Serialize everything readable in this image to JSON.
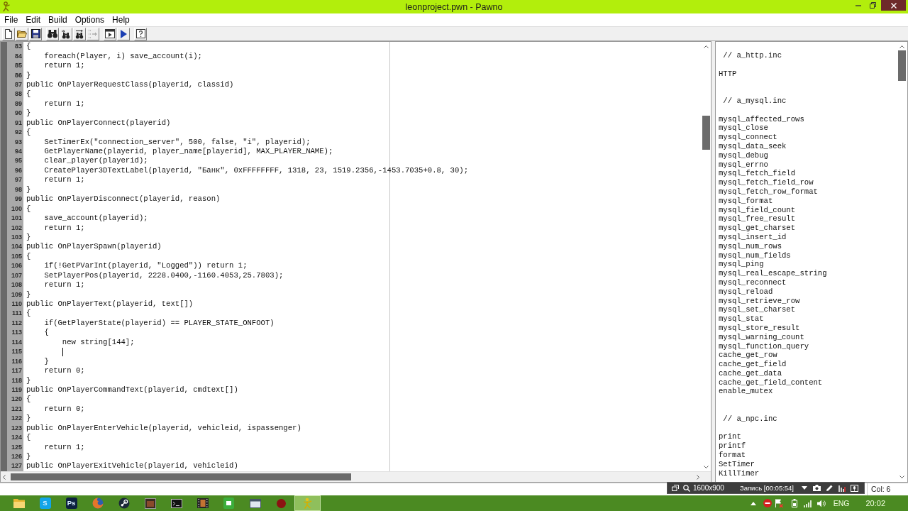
{
  "window": {
    "title": "leonproject.pwn - Pawno"
  },
  "menu": [
    "File",
    "Edit",
    "Build",
    "Options",
    "Help"
  ],
  "editor": {
    "lines": [
      {
        "number": "83",
        "text": "{",
        "caret": false
      },
      {
        "number": "84",
        "text": "    foreach(Player, i) save_account(i);",
        "caret": false
      },
      {
        "number": "85",
        "text": "    return 1;",
        "caret": false
      },
      {
        "number": "86",
        "text": "}",
        "caret": false
      },
      {
        "number": "87",
        "text": "public OnPlayerRequestClass(playerid, classid)",
        "caret": false
      },
      {
        "number": "88",
        "text": "{",
        "caret": false
      },
      {
        "number": "89",
        "text": "    return 1;",
        "caret": false
      },
      {
        "number": "90",
        "text": "}",
        "caret": false
      },
      {
        "number": "91",
        "text": "public OnPlayerConnect(playerid)",
        "caret": false
      },
      {
        "number": "92",
        "text": "{",
        "caret": false
      },
      {
        "number": "93",
        "text": "    SetTimerEx(\"connection_server\", 500, false, \"i\", playerid);",
        "caret": false
      },
      {
        "number": "94",
        "text": "    GetPlayerName(playerid, player_name[playerid], MAX_PLAYER_NAME);",
        "caret": false
      },
      {
        "number": "95",
        "text": "    clear_player(playerid);",
        "caret": false
      },
      {
        "number": "96",
        "text": "    CreatePlayer3DTextLabel(playerid, \"Банк\", 0xFFFFFFFF, 1318, 23, 1519.2356,-1453.7035+0.8, 30);",
        "caret": false
      },
      {
        "number": "97",
        "text": "    return 1;",
        "caret": false
      },
      {
        "number": "98",
        "text": "}",
        "caret": false
      },
      {
        "number": "99",
        "text": "public OnPlayerDisconnect(playerid, reason)",
        "caret": false
      },
      {
        "number": "100",
        "text": "{",
        "caret": false
      },
      {
        "number": "101",
        "text": "    save_account(playerid);",
        "caret": false
      },
      {
        "number": "102",
        "text": "    return 1;",
        "caret": false
      },
      {
        "number": "103",
        "text": "}",
        "caret": false
      },
      {
        "number": "104",
        "text": "public OnPlayerSpawn(playerid)",
        "caret": false
      },
      {
        "number": "105",
        "text": "{",
        "caret": false
      },
      {
        "number": "106",
        "text": "    if(!GetPVarInt(playerid, \"Logged\")) return 1;",
        "caret": false
      },
      {
        "number": "107",
        "text": "    SetPlayerPos(playerid, 2228.0400,-1160.4053,25.7803);",
        "caret": false
      },
      {
        "number": "108",
        "text": "    return 1;",
        "caret": false
      },
      {
        "number": "109",
        "text": "}",
        "caret": false
      },
      {
        "number": "110",
        "text": "public OnPlayerText(playerid, text[])",
        "caret": false
      },
      {
        "number": "111",
        "text": "{",
        "caret": false
      },
      {
        "number": "112",
        "text": "    if(GetPlayerState(playerid) == PLAYER_STATE_ONFOOT)",
        "caret": false
      },
      {
        "number": "113",
        "text": "    {",
        "caret": false
      },
      {
        "number": "114",
        "text": "        new string[144];",
        "caret": false
      },
      {
        "number": "115",
        "caret": true
      },
      {
        "number": "116",
        "text": "    }",
        "caret": false
      },
      {
        "number": "117",
        "text": "    return 0;",
        "caret": false
      },
      {
        "number": "118",
        "text": "}",
        "caret": false
      },
      {
        "number": "119",
        "text": "public OnPlayerCommandText(playerid, cmdtext[])",
        "caret": false
      },
      {
        "number": "120",
        "text": "{",
        "caret": false
      },
      {
        "number": "121",
        "text": "    return 0;",
        "caret": false
      },
      {
        "number": "122",
        "text": "}",
        "caret": false
      },
      {
        "number": "123",
        "text": "public OnPlayerEnterVehicle(playerid, vehicleid, ispassenger)",
        "caret": false
      },
      {
        "number": "124",
        "text": "{",
        "caret": false
      },
      {
        "number": "125",
        "text": "    return 1;",
        "caret": false
      },
      {
        "number": "126",
        "text": "}",
        "caret": false
      },
      {
        "number": "127",
        "text": "public OnPlayerExitVehicle(playerid, vehicleid)",
        "caret": false
      }
    ]
  },
  "function_list": {
    "groups": [
      {
        "header": "// a_http.inc",
        "items": [
          "HTTP"
        ]
      },
      {
        "header": "// a_mysql.inc",
        "items": [
          "mysql_affected_rows",
          "mysql_close",
          "mysql_connect",
          "mysql_data_seek",
          "mysql_debug",
          "mysql_errno",
          "mysql_fetch_field",
          "mysql_fetch_field_row",
          "mysql_fetch_row_format",
          "mysql_format",
          "mysql_field_count",
          "mysql_free_result",
          "mysql_get_charset",
          "mysql_insert_id",
          "mysql_num_rows",
          "mysql_num_fields",
          "mysql_ping",
          "mysql_real_escape_string",
          "mysql_reconnect",
          "mysql_reload",
          "mysql_retrieve_row",
          "mysql_set_charset",
          "mysql_stat",
          "mysql_store_result",
          "mysql_warning_count",
          "mysql_function_query",
          "cache_get_row",
          "cache_get_field",
          "cache_get_data",
          "cache_get_field_content",
          "enable_mutex"
        ]
      },
      {
        "header": "// a_npc.inc",
        "items": [
          "print",
          "printf",
          "format",
          "SetTimer",
          "KillTimer"
        ]
      }
    ]
  },
  "status_bar": {
    "column": "Col: 6"
  },
  "recorder_toolbar": {
    "resolution": "1600x900",
    "recording": "Запись [00:05:54]"
  },
  "taskbar": {
    "apps": [
      {
        "kind": "folder",
        "selected": false
      },
      {
        "kind": "letter-tile",
        "label": "S",
        "color": "#12a5e8",
        "selected": false
      },
      {
        "kind": "letter-tile",
        "label": "Ps",
        "color": "#0c2140",
        "selected": false
      },
      {
        "kind": "globe",
        "selected": false
      },
      {
        "kind": "ring",
        "selected": false
      },
      {
        "kind": "app-window",
        "selected": false
      },
      {
        "kind": "terminal",
        "selected": false
      },
      {
        "kind": "film",
        "selected": false
      },
      {
        "kind": "sheet",
        "selected": false
      },
      {
        "kind": "window",
        "selected": false
      },
      {
        "kind": "dot",
        "selected": false
      },
      {
        "kind": "figure",
        "selected": true
      }
    ],
    "language": "ENG",
    "clock": "20:02"
  }
}
